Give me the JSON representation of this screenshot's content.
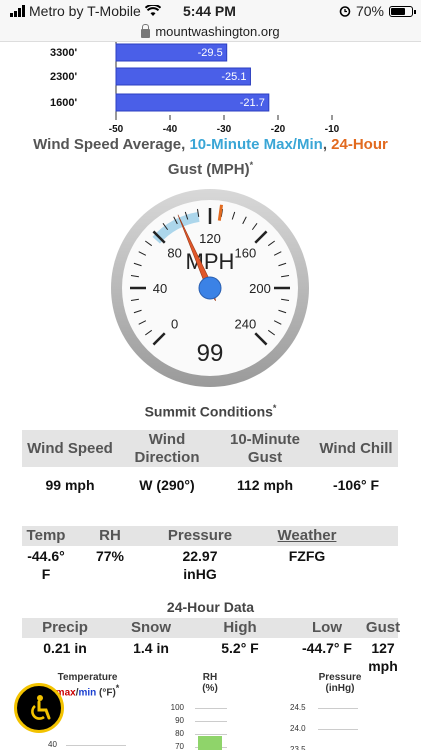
{
  "status_bar": {
    "carrier": "Metro by T-Mobile",
    "time": "5:44 PM",
    "battery": "70%"
  },
  "browser": {
    "url": "mountwashington.org"
  },
  "profile_chart": {
    "chart_data": {
      "type": "bar",
      "orientation": "horizontal",
      "categories": [
        "3300'",
        "2300'",
        "1600'"
      ],
      "values": [
        -29.5,
        -25.1,
        -21.7
      ],
      "value_labels": [
        "-29.5",
        "-25.1",
        "-21.7"
      ],
      "xlim": [
        -50,
        -10
      ],
      "xticks": [
        "-50",
        "-40",
        "-30",
        "-20",
        "-10"
      ]
    }
  },
  "wind_section": {
    "title_part1": "Wind Speed Average, ",
    "title_part2": "10-Minute Max/Min",
    "title_part3": ", ",
    "title_part4": "24-Hour",
    "title_part5": "Gust (MPH)",
    "asterisk": "*",
    "colors": {
      "gray": "#555555",
      "blue": "#3aa6d6",
      "orange": "#e26a1f"
    }
  },
  "gauge": {
    "unit": "MPH",
    "value": 99,
    "value_label": "99",
    "min": 0,
    "max": 240,
    "labels": [
      "0",
      "40",
      "80",
      "120",
      "160",
      "200",
      "240"
    ],
    "band_min": 77,
    "band_max": 112,
    "gust_24h": 127,
    "colors": {
      "needle": "#e0572a",
      "band": "#9ecfe8",
      "hub": "#3b82e6",
      "gust": "#e26a1f"
    }
  },
  "summit": {
    "title": "Summit Conditions",
    "asterisk": "*",
    "headers": [
      "Wind Speed",
      "Wind Direction",
      "10-Minute Gust",
      "Wind Chill"
    ],
    "values": [
      "99 mph",
      "W (290°)",
      "112 mph",
      "-106° F"
    ]
  },
  "current": {
    "headers": [
      "Temp",
      "RH",
      "Pressure",
      "Weather"
    ],
    "values": [
      "-44.6° F",
      "77%",
      "22.97 inHG",
      "FZFG"
    ]
  },
  "day24": {
    "title": "24-Hour Data",
    "headers": [
      "Precip",
      "Snow",
      "High",
      "Low",
      "Gust"
    ],
    "values": [
      "0.21 in",
      "1.4 in",
      "5.2° F",
      "-44.7° F",
      "127 mph"
    ]
  },
  "mini_charts": {
    "temperature": {
      "title": "Temperature",
      "max_label": "max",
      "slash": "/",
      "min_label": "min",
      "unit": " (°F)",
      "asterisk": "*",
      "ticks": [
        "40"
      ]
    },
    "rh": {
      "title": "RH",
      "unit": "(%)",
      "ticks": [
        "100",
        "90",
        "80",
        "70"
      ]
    },
    "pressure": {
      "title": "Pressure",
      "unit": "(inHg)",
      "ticks": [
        "24.5",
        "24.0",
        "23.5"
      ]
    }
  }
}
